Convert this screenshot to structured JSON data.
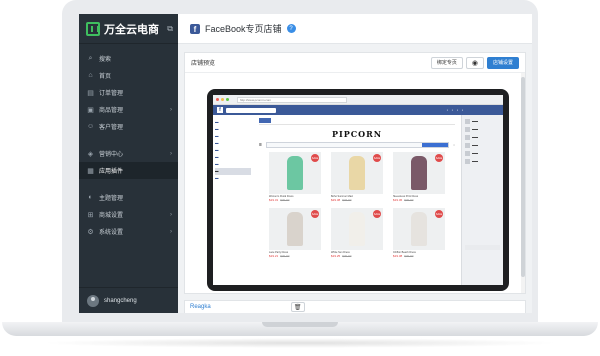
{
  "app": {
    "logo_text": "万全云电商",
    "open_external_icon": "external-link-icon"
  },
  "sidebar": {
    "items": [
      {
        "label": "搜索",
        "icon": "search-icon"
      },
      {
        "label": "首页",
        "icon": "home-icon"
      },
      {
        "label": "订单管理",
        "icon": "order-icon"
      },
      {
        "label": "商品管理",
        "icon": "product-icon"
      },
      {
        "label": "客户管理",
        "icon": "customer-icon"
      },
      {
        "label": "营销中心",
        "icon": "megaphone-icon"
      },
      {
        "label": "应用插件",
        "icon": "apps-icon"
      },
      {
        "label": "主题管理",
        "icon": "theme-icon"
      },
      {
        "label": "商城设置",
        "icon": "store-icon"
      },
      {
        "label": "系统设置",
        "icon": "gear-icon"
      }
    ],
    "user": {
      "name": "shangcheng"
    }
  },
  "header": {
    "title": "FaceBook专页店铺"
  },
  "panel": {
    "title": "店铺预览",
    "bind_button": "绑定专页",
    "settings_button": "店铺设置"
  },
  "preview": {
    "url": "http://www.pcomm.com",
    "brand": "PIPCORN",
    "products": [
      {
        "name": "Women's Floral Dress",
        "price": "$19.31",
        "old": "$30.00",
        "color": "#6cc7a2"
      },
      {
        "name": "Boho Summer Maxi",
        "price": "$29.38",
        "old": "$46.00",
        "color": "#e9d7a6"
      },
      {
        "name": "Sleeveless Print Dress",
        "price": "$19.36",
        "old": "$30.00",
        "color": "#7a5968"
      },
      {
        "name": "Lace Party Dress",
        "price": "$19.21",
        "old": "$30.00",
        "color": "#d9d3cc"
      },
      {
        "name": "White Sun Dress",
        "price": "$19.25",
        "old": "$30.00",
        "color": "#f1efea"
      },
      {
        "name": "Chiffon Beach Dress",
        "price": "$19.38",
        "old": "$30.00",
        "color": "#e6e3df"
      }
    ]
  },
  "footer": {
    "link": "Reagka"
  }
}
